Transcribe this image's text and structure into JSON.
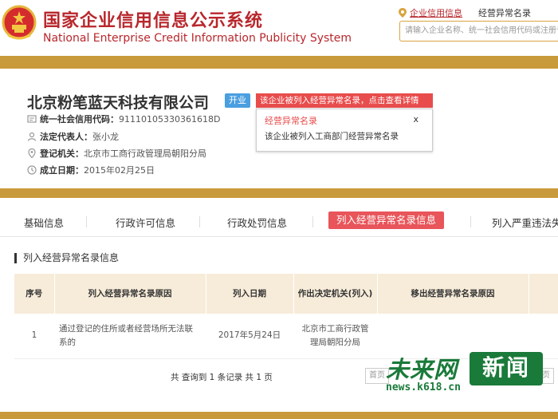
{
  "header": {
    "title_cn": "国家企业信用信息公示系统",
    "title_en": "National Enterprise Credit Information Publicity System",
    "nav": {
      "credit_info": "企业信用信息",
      "abnormal_list": "经营异常名录"
    },
    "search_placeholder": "请输入企业名称、统一社会信用代码或注册号"
  },
  "company": {
    "name": "北京粉笔蓝天科技有限公司",
    "status": "开业",
    "alert": "该企业被列入经营异常名录，点击查看详情",
    "popup": {
      "title": "经营异常名录",
      "close": "x",
      "body": "该企业被列入工商部门经营异常名录"
    },
    "info": [
      {
        "label": "统一社会信用代码：",
        "value": "91110105330361618D"
      },
      {
        "label": "法定代表人：",
        "value": "张小龙"
      },
      {
        "label": "登记机关：",
        "value": "北京市工商行政管理局朝阳分局"
      },
      {
        "label": "成立日期：",
        "value": "2015年02月25日"
      }
    ]
  },
  "tabs": [
    "基础信息",
    "行政许可信息",
    "行政处罚信息",
    "列入经营异常名录信息",
    "列入严重违法失"
  ],
  "section_title": "列入经营异常名录信息",
  "table": {
    "headers": [
      "序号",
      "列入经营异常名录原因",
      "列入日期",
      "作出决定机关(列入)",
      "移出经营异常名录原因"
    ],
    "rows": [
      [
        "1",
        "通过登记的住所或者经营场所无法联系的",
        "2017年5月24日",
        "北京市工商行政管理局朝阳分局",
        ""
      ]
    ]
  },
  "pager": {
    "text": "共 查询到 1 条记录 共 1 页",
    "first": "首页",
    "last": "末页"
  },
  "watermark": {
    "cn1": "未来网",
    "cn2": "新闻",
    "url": "news.k618.cn"
  }
}
